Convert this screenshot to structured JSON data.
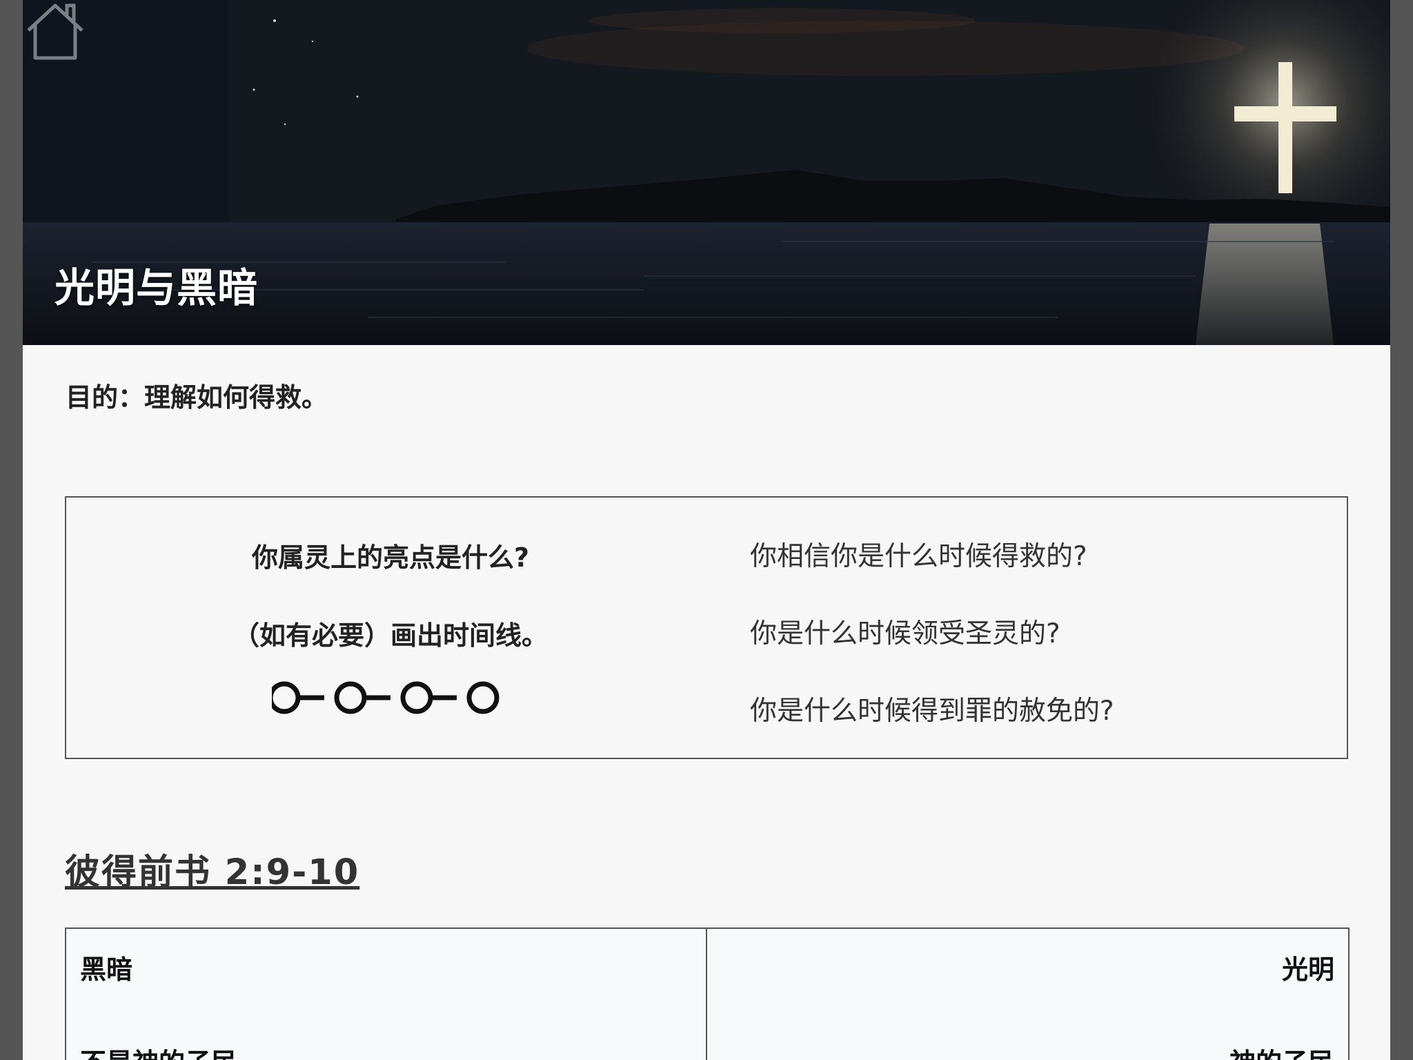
{
  "hero": {
    "title": "光明与黑暗",
    "home_icon": "home-icon"
  },
  "purpose": "目的：理解如何得救。",
  "question_box": {
    "left": {
      "question": "你属灵上的亮点是什么?",
      "instruction": "（如有必要）画出时间线。",
      "timeline_icon": "timeline-icon"
    },
    "right": [
      "你相信你是什么时候得救的?",
      "你是什么时候领受圣灵的?",
      "你是什么时候得到罪的赦免的?"
    ]
  },
  "scripture": "彼得前书 2:9-10",
  "comparison": {
    "left_header": "黑暗",
    "right_header": "光明",
    "rows": [
      {
        "left": "不是神的子民",
        "right": "神的子民"
      }
    ]
  }
}
